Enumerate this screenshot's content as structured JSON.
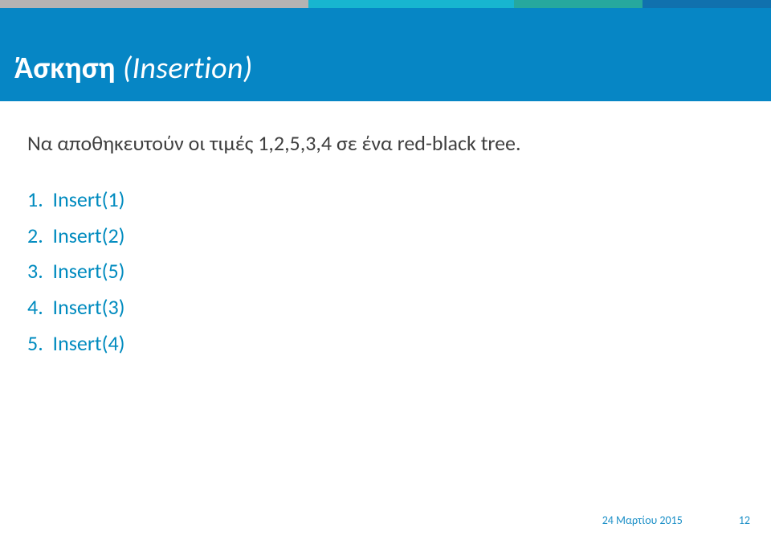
{
  "title": {
    "bold": "Άσκηση",
    "italic": "(Insertion)"
  },
  "intro": "Να αποθηκευτούν οι τιμές 1,2,5,3,4 σε ένα red-black tree.",
  "steps": [
    "Insert(1)",
    "Insert(2)",
    "Insert(5)",
    "Insert(3)",
    "Insert(4)"
  ],
  "footer": {
    "date": "24 Μαρτίου 2015",
    "page": "12"
  }
}
